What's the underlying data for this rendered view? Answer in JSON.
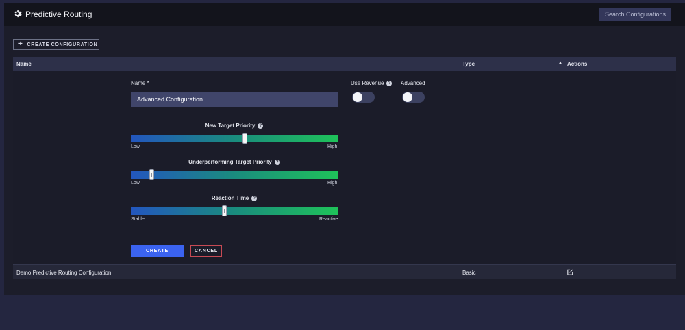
{
  "header": {
    "title": "Predictive Routing",
    "icon": "gear-icon",
    "search_placeholder": "Search Configurations"
  },
  "toolbar": {
    "create_configuration_label": "CREATE CONFIGURATION",
    "create_icon": "plus-icon"
  },
  "table": {
    "columns": {
      "name": "Name",
      "type": "Type",
      "actions": "Actions"
    },
    "sort": {
      "column": "Actions",
      "direction": "ascending",
      "icon": "sort-up-icon"
    },
    "rows": [
      {
        "name": "Demo Predictive Routing Configuration",
        "type": "Basic",
        "action_icon": "edit-icon"
      }
    ]
  },
  "form": {
    "name_label": "Name *",
    "name_value": "Advanced Configuration",
    "use_revenue": {
      "label": "Use Revenue",
      "on": false,
      "help_icon": "help-icon"
    },
    "advanced": {
      "label": "Advanced",
      "on": false
    },
    "sliders": [
      {
        "label": "New Target Priority",
        "min_label": "Low",
        "max_label": "High",
        "value": 0.55
      },
      {
        "label": "Underperforming Target Priority",
        "min_label": "Low",
        "max_label": "High",
        "value": 0.1
      },
      {
        "label": "Reaction Time",
        "min_label": "Stable",
        "max_label": "Reactive",
        "value": 0.45
      }
    ],
    "create_label": "CREATE",
    "cancel_label": "CANCEL"
  },
  "colors": {
    "accent": "#3b63f0",
    "cancel_border": "#c74a54",
    "gradient_start": "#2356bf",
    "gradient_end": "#1fc25a"
  }
}
